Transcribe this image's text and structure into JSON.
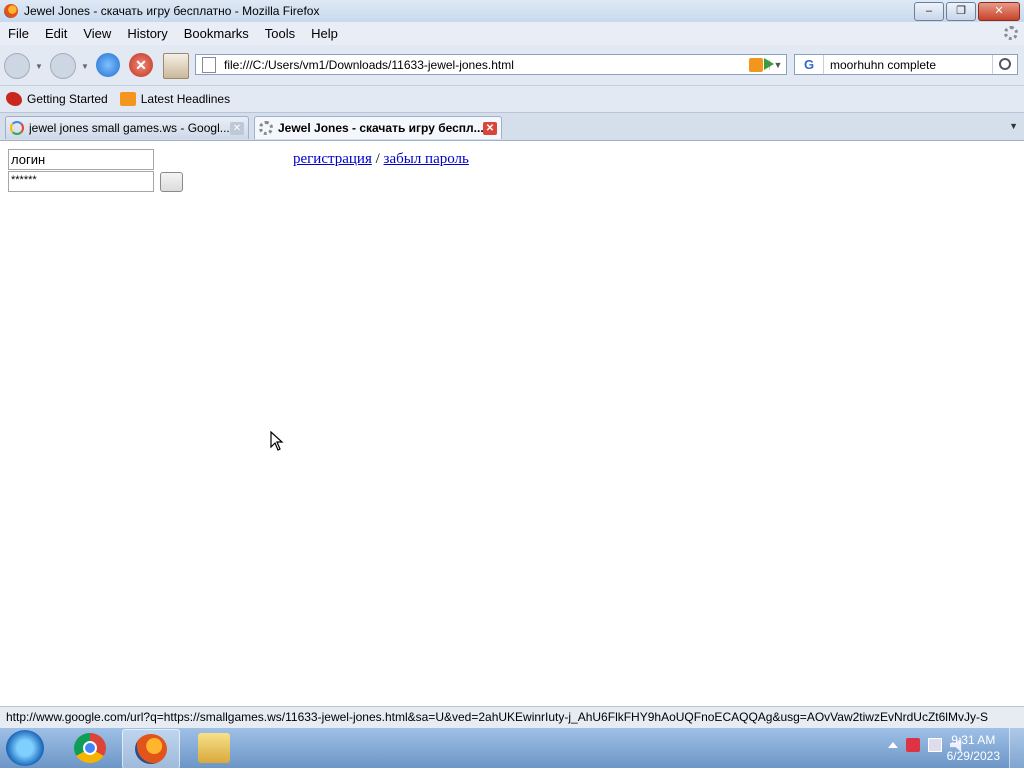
{
  "window": {
    "title": "Jewel Jones - скачать игру бесплатно - Mozilla Firefox"
  },
  "menu": [
    "File",
    "Edit",
    "View",
    "History",
    "Bookmarks",
    "Tools",
    "Help"
  ],
  "nav": {
    "url": "file:///C:/Users/vm1/Downloads/11633-jewel-jones.html",
    "search_engine": "G",
    "search_query": "moorhuhn complete"
  },
  "bookmarks": [
    {
      "label": "Getting Started",
      "icon": "firefox-red-icon"
    },
    {
      "label": "Latest Headlines",
      "icon": "rss-icon"
    }
  ],
  "tabs": [
    {
      "label": "jewel jones small games.ws - Googl...",
      "icon": "google-icon",
      "active": false
    },
    {
      "label": "Jewel Jones - скачать игру беспл...",
      "icon": "loading-icon",
      "active": true
    }
  ],
  "page": {
    "login_value": "логин",
    "password_value": "******",
    "register_link": "регистрация",
    "separator": " / ",
    "forgot_link": "забыл пароль"
  },
  "status": {
    "text": "http://www.google.com/url?q=https://smallgames.ws/11633-jewel-jones.html&sa=U&ved=2ahUKEwinrIuty-j_AhU6FlkFHY9hAoUQFnoECAQQAg&usg=AOvVaw2tiwzEvNrdUcZt6lMvJy-S"
  },
  "taskbar": {
    "time": "9:31 AM",
    "date": "6/29/2023"
  }
}
